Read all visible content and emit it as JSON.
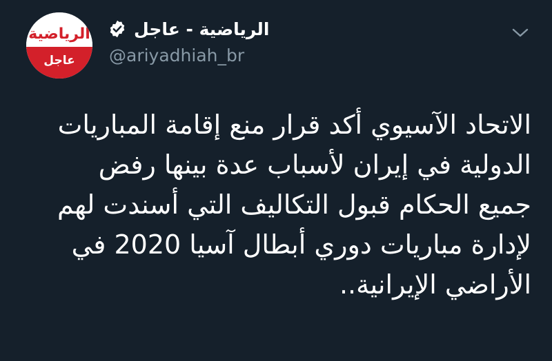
{
  "account": {
    "display_name": "الرياضية - عاجل",
    "handle": "@ariyadhiah_br",
    "verified_icon": "verified-badge-icon",
    "avatar": {
      "brand_text": "الرياضية",
      "tag_text": "عاجل",
      "brand_color": "#d3202a"
    }
  },
  "menu": {
    "icon": "chevron-down-icon"
  },
  "tweet": {
    "lines": [
      "الاتحاد الآسيوي أكد قرار منع إقامة المباريات",
      "الدولية في إيران لأسباب عدة بينها رفض",
      "جميع الحكام قبول التكاليف التي أسندت لهم",
      "لإدارة مباريات دوري أبطال آسيا 2020 في",
      "الأراضي الإيرانية.."
    ]
  },
  "colors": {
    "background": "#15202b",
    "text": "#ffffff",
    "secondary_text": "#8899a6"
  }
}
